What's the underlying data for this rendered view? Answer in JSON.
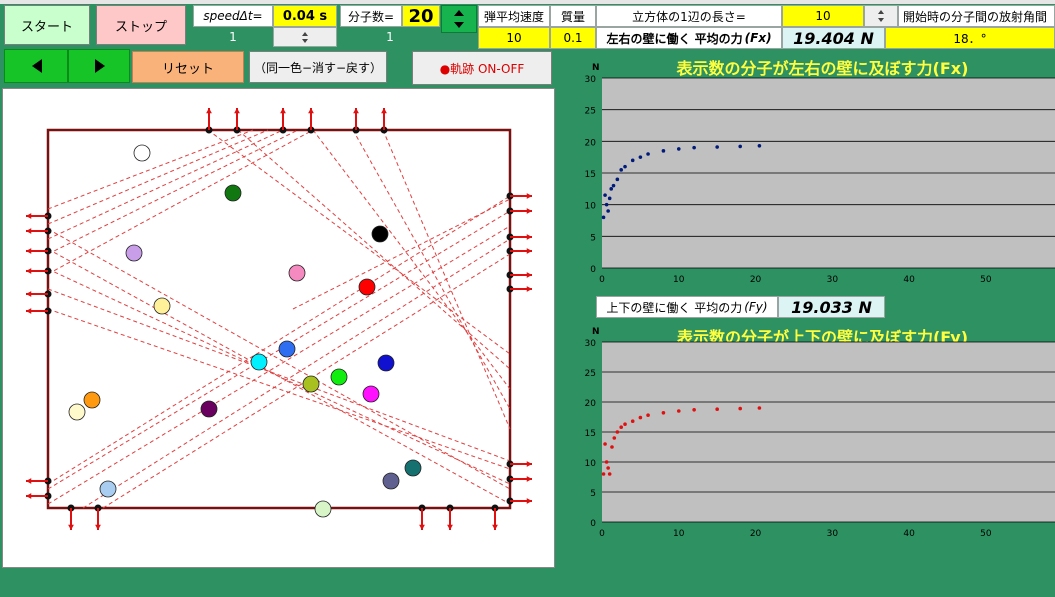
{
  "controls": {
    "start_label": "スタート",
    "stop_label": "ストップ",
    "reset_label": "リセット",
    "same_color_label": "（同一色−消す−戻す）",
    "trail_label": "●軌跡 ON-OFF",
    "prev_icon": "triangle-left-icon",
    "next_icon": "triangle-right-icon"
  },
  "params": {
    "speed_label": "speedΔt=",
    "speed_value": "0.04 s",
    "speed_index": "1",
    "molecule_label": "分子数=",
    "molecule_value": "20",
    "molecule_index": "1",
    "elastic_label": "弾平均速度",
    "elastic_value": "10",
    "mass_label": "質量",
    "mass_value": "0.1",
    "cube_label": "立方体の1辺の長さ=",
    "cube_value": "10",
    "angle_label": "開始時の分子間の放射角間",
    "angle_value": "18．°",
    "fx_label": "左右の壁に働く  平均の力",
    "fx_symbol": "(Fx)",
    "fx_value": "19.404  N",
    "fy_label": "上下の壁に働く  平均の力",
    "fy_symbol": "(Fy)",
    "fy_value": "19.033  N"
  },
  "charts": {
    "fx_title": "表示数の分子が左右の壁に及ぼす力(Fx)",
    "fy_title": "表示数の分子が上下の壁に及ぼす力(Fy)"
  },
  "chart_data": [
    {
      "type": "scatter",
      "title": "表示数の分子が左右の壁に及ぼす力(Fx)",
      "ylabel": "N",
      "xlim": [
        0,
        59
      ],
      "ylim": [
        0,
        30
      ],
      "xticks": [
        0,
        10,
        20,
        30,
        40,
        50
      ],
      "yticks": [
        0,
        5,
        10,
        15,
        20,
        25,
        30
      ],
      "grid": true,
      "color": "#001a7a",
      "x": [
        0.2,
        0.4,
        0.6,
        0.8,
        1.0,
        1.2,
        1.5,
        2.0,
        2.5,
        3.0,
        4.0,
        5.0,
        6.0,
        8.0,
        10.0,
        12.0,
        15.0,
        18.0,
        20.5
      ],
      "y": [
        8.0,
        11.5,
        10.0,
        9.0,
        11.0,
        12.5,
        13.0,
        14.0,
        15.5,
        16.0,
        17.0,
        17.5,
        18.0,
        18.5,
        18.8,
        19.0,
        19.1,
        19.2,
        19.3
      ]
    },
    {
      "type": "scatter",
      "title": "表示数の分子が上下の壁に及ぼす力(Fy)",
      "ylabel": "N",
      "xlim": [
        0,
        59
      ],
      "ylim": [
        0,
        30
      ],
      "xticks": [
        0,
        10,
        20,
        30,
        40,
        50
      ],
      "yticks": [
        0,
        5,
        10,
        15,
        20,
        25,
        30
      ],
      "grid": true,
      "color": "#e01010",
      "x": [
        0.2,
        0.4,
        0.6,
        0.8,
        1.0,
        1.3,
        1.6,
        2.0,
        2.5,
        3.0,
        4.0,
        5.0,
        6.0,
        8.0,
        10.0,
        12.0,
        15.0,
        18.0,
        20.5
      ],
      "y": [
        8.0,
        13.0,
        10.0,
        9.0,
        8.0,
        12.5,
        14.0,
        15.0,
        15.8,
        16.3,
        16.8,
        17.4,
        17.8,
        18.2,
        18.5,
        18.7,
        18.8,
        18.9,
        19.0
      ]
    }
  ],
  "simulation": {
    "molecule_colors": [
      "#ffffff",
      "#117711",
      "#000000",
      "#c89ee8",
      "#f48ac0",
      "#ff0000",
      "#fff09a",
      "#2f6ef0",
      "#00f0ff",
      "#1010d0",
      "#a8c020",
      "#10ee10",
      "#ff10ff",
      "#ff9a10",
      "#fffacc",
      "#6a0060",
      "#157070",
      "#606090",
      "#a8cdf0",
      "#d8f5c8"
    ]
  }
}
